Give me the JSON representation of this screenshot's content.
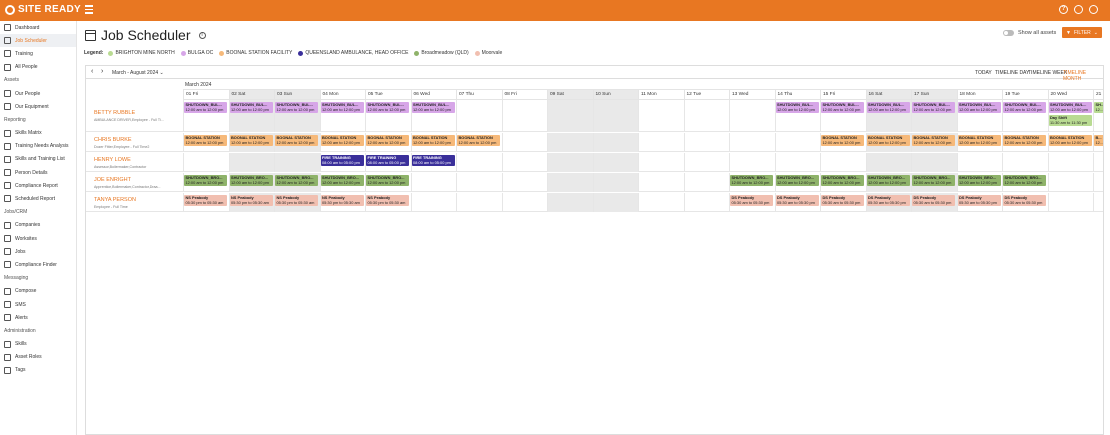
{
  "app": {
    "logo": "SITE READY"
  },
  "sidebar": {
    "top": [
      {
        "label": "Dashboard"
      },
      {
        "label": "Job Scheduler",
        "active": true
      },
      {
        "label": "Training"
      },
      {
        "label": "All People"
      }
    ],
    "sections": [
      {
        "heading": "Assets",
        "items": [
          {
            "label": "Our People"
          },
          {
            "label": "Our Equipment"
          }
        ]
      },
      {
        "heading": "Reporting",
        "items": [
          {
            "label": "Skills Matrix"
          },
          {
            "label": "Training Needs Analysis"
          },
          {
            "label": "Skills and Training List"
          },
          {
            "label": "Person Details"
          },
          {
            "label": "Compliance Report"
          },
          {
            "label": "Scheduled Report"
          }
        ]
      },
      {
        "heading": "Jobs/CRM",
        "items": [
          {
            "label": "Companies"
          },
          {
            "label": "Worksites"
          },
          {
            "label": "Jobs"
          },
          {
            "label": "Compliance Finder"
          }
        ]
      },
      {
        "heading": "Messaging",
        "items": [
          {
            "label": "Compose"
          },
          {
            "label": "SMS"
          },
          {
            "label": "Alerts"
          }
        ]
      },
      {
        "heading": "Administration",
        "items": [
          {
            "label": "Skills"
          },
          {
            "label": "Asset Roles"
          },
          {
            "label": "Tags"
          }
        ]
      }
    ]
  },
  "page": {
    "title": "Job Scheduler",
    "show_all_label": "Show all assets",
    "filter_label": "FILTER"
  },
  "legend": {
    "label": "Legend:",
    "items": [
      {
        "name": "BRIGHTON MINE NORTH",
        "color": "#b9db92"
      },
      {
        "name": "BULGA OC",
        "color": "#d7a6e8"
      },
      {
        "name": "BOONAL STATION FACILITY",
        "color": "#f6b97a"
      },
      {
        "name": "QUEENSLAND AMBULANCE, HEAD OFFICE",
        "color": "#3a2f9a"
      },
      {
        "name": "Broadmeadow (QLD)",
        "color": "#8fb36a"
      },
      {
        "name": "Moorvale",
        "color": "#f1bfb0"
      }
    ]
  },
  "toolbar": {
    "prev": "‹",
    "next": "›",
    "range": "March - August 2024",
    "views": [
      {
        "label": "TODAY",
        "active": false
      },
      {
        "label": "TIMELINE DAY",
        "active": false
      },
      {
        "label": "TIMELINE WEEK",
        "active": false
      },
      {
        "label": "TIMELINE MONTH",
        "active": true
      }
    ]
  },
  "month_label": "March 2024",
  "days": [
    {
      "label": "01 Fri",
      "weekend": false
    },
    {
      "label": "02 Sat",
      "weekend": true
    },
    {
      "label": "03 Sun",
      "weekend": true
    },
    {
      "label": "04 Mon",
      "weekend": false
    },
    {
      "label": "05 Tue",
      "weekend": false
    },
    {
      "label": "06 Wed",
      "weekend": false
    },
    {
      "label": "07 Thu",
      "weekend": false
    },
    {
      "label": "08 Fri",
      "weekend": false
    },
    {
      "label": "09 Sat",
      "weekend": true
    },
    {
      "label": "10 Sun",
      "weekend": true
    },
    {
      "label": "11 Mon",
      "weekend": false
    },
    {
      "label": "12 Tue",
      "weekend": false
    },
    {
      "label": "13 Wed",
      "weekend": false
    },
    {
      "label": "14 Thu",
      "weekend": false
    },
    {
      "label": "15 Fri",
      "weekend": false
    },
    {
      "label": "16 Sat",
      "weekend": true
    },
    {
      "label": "17 Sun",
      "weekend": true
    },
    {
      "label": "18 Mon",
      "weekend": false
    },
    {
      "label": "19 Tue",
      "weekend": false
    },
    {
      "label": "20 Wed",
      "weekend": false
    },
    {
      "label": "21",
      "weekend": false
    }
  ],
  "people": [
    {
      "name": "BETTY RUBBLE",
      "sub": "AMBULANCE DRIVER,Employee - Full Ti...",
      "lanes": [
        [
          {
            "day": 0,
            "title": "SHUTDOWN_BUL...",
            "time": "12:00 am to 12:00 pm",
            "style": "bulga"
          },
          {
            "day": 1,
            "title": "SHUTDOWN_BUL...",
            "time": "12:00 am to 12:00 pm",
            "style": "bulga"
          },
          {
            "day": 2,
            "title": "SHUTDOWN_BUL...",
            "time": "12:00 am to 12:00 pm",
            "style": "bulga"
          },
          {
            "day": 3,
            "title": "SHUTDOWN_BUL...",
            "time": "12:00 am to 12:00 pm",
            "style": "bulga"
          },
          {
            "day": 4,
            "title": "SHUTDOWN_BUL...",
            "time": "12:00 am to 12:00 pm",
            "style": "bulga"
          },
          {
            "day": 5,
            "title": "SHUTDOWN_BUL...",
            "time": "12:00 am to 12:00 pm",
            "style": "bulga"
          },
          {
            "day": 13,
            "title": "SHUTDOWN_BUL...",
            "time": "12:00 am to 12:00 pm",
            "style": "bulga"
          },
          {
            "day": 14,
            "title": "SHUTDOWN_BUL...",
            "time": "12:00 am to 12:00 pm",
            "style": "bulga"
          },
          {
            "day": 15,
            "title": "SHUTDOWN_BUL...",
            "time": "12:00 am to 12:00 pm",
            "style": "bulga"
          },
          {
            "day": 16,
            "title": "SHUTDOWN_BUL...",
            "time": "12:00 am to 12:00 pm",
            "style": "bulga"
          },
          {
            "day": 17,
            "title": "SHUTDOWN_BUL...",
            "time": "12:00 am to 12:00 pm",
            "style": "bulga"
          },
          {
            "day": 18,
            "title": "SHUTDOWN_BUL...",
            "time": "12:00 am to 12:00 pm",
            "style": "bulga"
          },
          {
            "day": 19,
            "title": "SHUTDOWN_BUL...",
            "time": "12:00 am to 12:00 pm",
            "style": "bulga"
          },
          {
            "day": 20,
            "title": "SH...",
            "time": "12...",
            "style": "brighton"
          }
        ],
        [
          {
            "day": 19,
            "title": "Day Shift",
            "time": "11:30 am to 11:30 pm",
            "style": "brighton"
          }
        ]
      ]
    },
    {
      "name": "CHRIS BURKE",
      "sub": "Dozer Fitter,Employee - Full Time2",
      "lanes": [
        [
          {
            "day": 0,
            "title": "BOONAL STATION",
            "time": "12:00 am to 12:00 pm",
            "style": "boonal"
          },
          {
            "day": 1,
            "title": "BOONAL STATION",
            "time": "12:00 am to 12:00 pm",
            "style": "boonal"
          },
          {
            "day": 2,
            "title": "BOONAL STATION",
            "time": "12:00 am to 12:00 pm",
            "style": "boonal"
          },
          {
            "day": 3,
            "title": "BOONAL STATION",
            "time": "12:00 am to 12:00 pm",
            "style": "boonal"
          },
          {
            "day": 4,
            "title": "BOONAL STATION",
            "time": "12:00 am to 12:00 pm",
            "style": "boonal"
          },
          {
            "day": 5,
            "title": "BOONAL STATION",
            "time": "12:00 am to 12:00 pm",
            "style": "boonal"
          },
          {
            "day": 6,
            "title": "BOONAL STATION",
            "time": "12:00 am to 12:00 pm",
            "style": "boonal"
          },
          {
            "day": 14,
            "title": "BOONAL STATION",
            "time": "12:00 am to 12:00 pm",
            "style": "boonal"
          },
          {
            "day": 15,
            "title": "BOONAL STATION",
            "time": "12:00 am to 12:00 pm",
            "style": "boonal"
          },
          {
            "day": 16,
            "title": "BOONAL STATION",
            "time": "12:00 am to 12:00 pm",
            "style": "boonal"
          },
          {
            "day": 17,
            "title": "BOONAL STATION",
            "time": "12:00 am to 12:00 pm",
            "style": "boonal"
          },
          {
            "day": 18,
            "title": "BOONAL STATION",
            "time": "12:00 am to 12:00 pm",
            "style": "boonal"
          },
          {
            "day": 19,
            "title": "BOONAL STATION",
            "time": "12:00 am to 12:00 pm",
            "style": "boonal"
          },
          {
            "day": 20,
            "title": "B...",
            "time": "12...",
            "style": "boonal"
          }
        ]
      ]
    },
    {
      "name": "HENRY LOWE",
      "sub": "Assessor,Boilermaker,Contractor",
      "lanes": [
        [
          {
            "day": 3,
            "title": "FIRE TRAINING",
            "time": "08:00 am to 05:00 pm",
            "style": "qld"
          },
          {
            "day": 4,
            "title": "FIRE TRAINING",
            "time": "08:00 am to 05:00 pm",
            "style": "qld"
          },
          {
            "day": 5,
            "title": "FIRE TRAINING",
            "time": "08:00 am to 05:00 pm",
            "style": "qld"
          }
        ]
      ]
    },
    {
      "name": "JOE ENRIGHT",
      "sub": "Apprentice,Boilermaker,Contractor,Draa...",
      "lanes": [
        [
          {
            "day": 0,
            "title": "SHUTDOWN_BRO...",
            "time": "12:00 am to 12:00 pm",
            "style": "broad"
          },
          {
            "day": 1,
            "title": "SHUTDOWN_BRO...",
            "time": "12:00 am to 12:00 pm",
            "style": "broad"
          },
          {
            "day": 2,
            "title": "SHUTDOWN_BRO...",
            "time": "12:00 am to 12:00 pm",
            "style": "broad"
          },
          {
            "day": 3,
            "title": "SHUTDOWN_BRO...",
            "time": "12:00 am to 12:00 pm",
            "style": "broad"
          },
          {
            "day": 4,
            "title": "SHUTDOWN_BRO...",
            "time": "12:00 am to 12:00 pm",
            "style": "broad"
          },
          {
            "day": 12,
            "title": "SHUTDOWN_BRO...",
            "time": "12:00 am to 12:00 pm",
            "style": "broad"
          },
          {
            "day": 13,
            "title": "SHUTDOWN_BRO...",
            "time": "12:00 am to 12:00 pm",
            "style": "broad"
          },
          {
            "day": 14,
            "title": "SHUTDOWN_BRO...",
            "time": "12:00 am to 12:00 pm",
            "style": "broad"
          },
          {
            "day": 15,
            "title": "SHUTDOWN_BRO...",
            "time": "12:00 am to 12:00 pm",
            "style": "broad"
          },
          {
            "day": 16,
            "title": "SHUTDOWN_BRO...",
            "time": "12:00 am to 12:00 pm",
            "style": "broad"
          },
          {
            "day": 17,
            "title": "SHUTDOWN_BRO...",
            "time": "12:00 am to 12:00 pm",
            "style": "broad"
          },
          {
            "day": 18,
            "title": "SHUTDOWN_BRO...",
            "time": "12:00 am to 12:00 pm",
            "style": "broad"
          }
        ]
      ]
    },
    {
      "name": "TANYA PERSON",
      "sub": "Employee - Full Time",
      "lanes": [
        [
          {
            "day": 0,
            "title": "NS Peabody",
            "time": "05:30 pm to 05:30 am",
            "style": "moor"
          },
          {
            "day": 1,
            "title": "NS Peabody",
            "time": "05:30 pm to 05:30 am",
            "style": "moor"
          },
          {
            "day": 2,
            "title": "NS Peabody",
            "time": "05:30 pm to 05:30 am",
            "style": "moor"
          },
          {
            "day": 3,
            "title": "NS Peabody",
            "time": "05:30 pm to 05:30 am",
            "style": "moor"
          },
          {
            "day": 4,
            "title": "NS Peabody",
            "time": "05:30 pm to 05:30 am",
            "style": "moor"
          },
          {
            "day": 12,
            "title": "DS Peabody",
            "time": "05:30 am to 05:30 pm",
            "style": "moor"
          },
          {
            "day": 13,
            "title": "DS Peabody",
            "time": "05:30 am to 05:30 pm",
            "style": "moor"
          },
          {
            "day": 14,
            "title": "DS Peabody",
            "time": "05:30 am to 05:30 pm",
            "style": "moor"
          },
          {
            "day": 15,
            "title": "DS Peabody",
            "time": "05:30 am to 05:30 pm",
            "style": "moor"
          },
          {
            "day": 16,
            "title": "DS Peabody",
            "time": "05:30 am to 05:30 pm",
            "style": "moor"
          },
          {
            "day": 17,
            "title": "DS Peabody",
            "time": "05:30 am to 05:30 pm",
            "style": "moor"
          },
          {
            "day": 18,
            "title": "DS Peabody",
            "time": "05:30 am to 05:30 pm",
            "style": "moor"
          }
        ]
      ]
    }
  ],
  "event_styles": {
    "bulga": {
      "bg": "#d7a6e8",
      "fg": "#222"
    },
    "brighton": {
      "bg": "#b9db92",
      "fg": "#222"
    },
    "boonal": {
      "bg": "#f6b97a",
      "fg": "#222"
    },
    "qld": {
      "bg": "#3a2f9a",
      "fg": "#ffffff"
    },
    "broad": {
      "bg": "#8fb36a",
      "fg": "#222"
    },
    "moor": {
      "bg": "#f1bfb0",
      "fg": "#222"
    }
  }
}
